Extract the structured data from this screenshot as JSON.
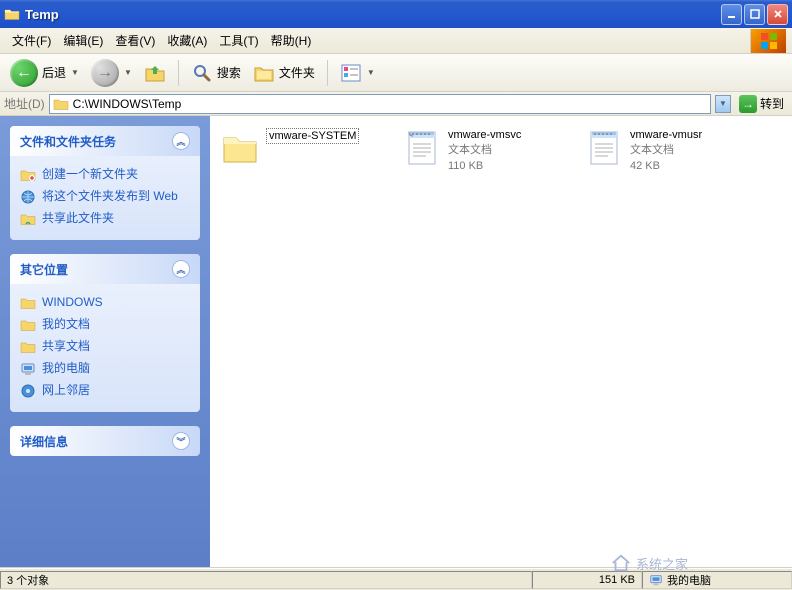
{
  "window": {
    "title": "Temp"
  },
  "menu": {
    "file": "文件(F)",
    "edit": "编辑(E)",
    "view": "查看(V)",
    "favorites": "收藏(A)",
    "tools": "工具(T)",
    "help": "帮助(H)"
  },
  "toolbar": {
    "back_label": "后退",
    "search_label": "搜索",
    "folders_label": "文件夹"
  },
  "addressbar": {
    "label": "地址(D)",
    "value": "C:\\WINDOWS\\Temp",
    "go_label": "转到"
  },
  "sidebar": {
    "panel1": {
      "title": "文件和文件夹任务",
      "items": [
        "创建一个新文件夹",
        "将这个文件夹发布到 Web",
        "共享此文件夹"
      ]
    },
    "panel2": {
      "title": "其它位置",
      "items": [
        "WINDOWS",
        "我的文档",
        "共享文档",
        "我的电脑",
        "网上邻居"
      ]
    },
    "panel3": {
      "title": "详细信息"
    }
  },
  "content": {
    "items": [
      {
        "name": "vmware-SYSTEM",
        "type": "folder",
        "selected": true
      },
      {
        "name": "vmware-vmsvc",
        "type": "txt",
        "desc": "文本文档",
        "size": "110 KB"
      },
      {
        "name": "vmware-vmusr",
        "type": "txt",
        "desc": "文本文档",
        "size": "42 KB"
      }
    ]
  },
  "statusbar": {
    "objects": "3 个对象",
    "size": "151 KB",
    "location": "我的电脑"
  },
  "watermark": "系统之家"
}
